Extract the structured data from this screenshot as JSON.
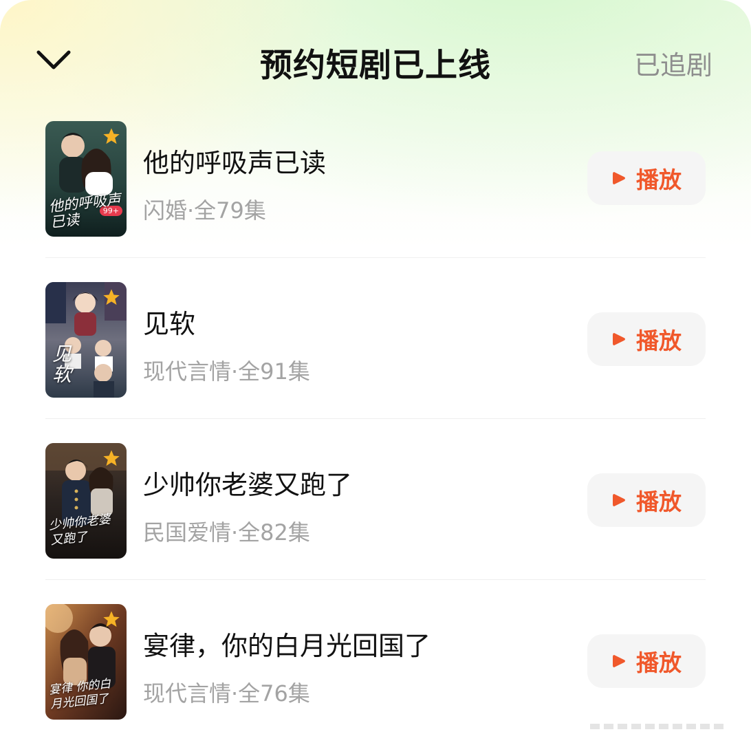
{
  "header": {
    "title": "预约短剧已上线",
    "right_action": "已追剧"
  },
  "colors": {
    "accent": "#f0582b",
    "star": "#f6b226",
    "title_text": "#111111",
    "meta_text": "#a3a3a3"
  },
  "items": [
    {
      "title": "他的呼吸声已读",
      "meta": "闪婚·全79集",
      "poster_text": "他的呼吸声 已读",
      "poster_badge": "99+",
      "play_label": "播放"
    },
    {
      "title": "见软",
      "meta": "现代言情·全91集",
      "poster_text": "见软",
      "play_label": "播放"
    },
    {
      "title": "少帅你老婆又跑了",
      "meta": "民国爱情·全82集",
      "poster_text": "少帅你老婆 又跑了",
      "play_label": "播放"
    },
    {
      "title": "宴律，你的白月光回国了",
      "meta": "现代言情·全76集",
      "poster_text": "宴律 你的白月光回国了",
      "play_label": "播放"
    }
  ]
}
